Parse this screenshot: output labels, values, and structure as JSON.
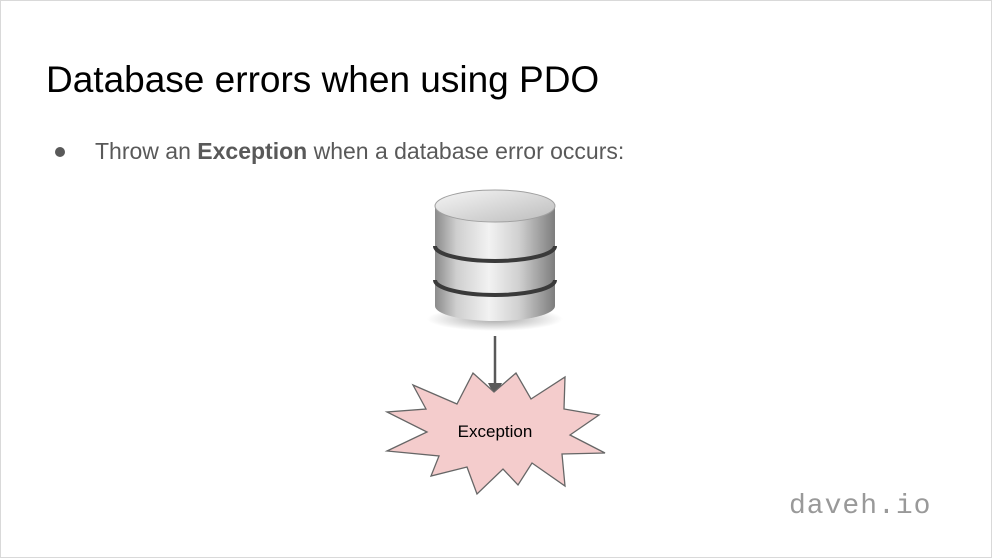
{
  "slide": {
    "title": "Database errors when using PDO",
    "bullet": {
      "prefix": "Throw an ",
      "bold": "Exception",
      "suffix": " when a database error occurs:"
    },
    "diagram": {
      "database_icon": "database-icon",
      "arrow_icon": "down-arrow-icon",
      "exception_label": "Exception",
      "exception_fill": "#f4cccc",
      "exception_stroke": "#666666"
    },
    "watermark": "daveh.io"
  }
}
